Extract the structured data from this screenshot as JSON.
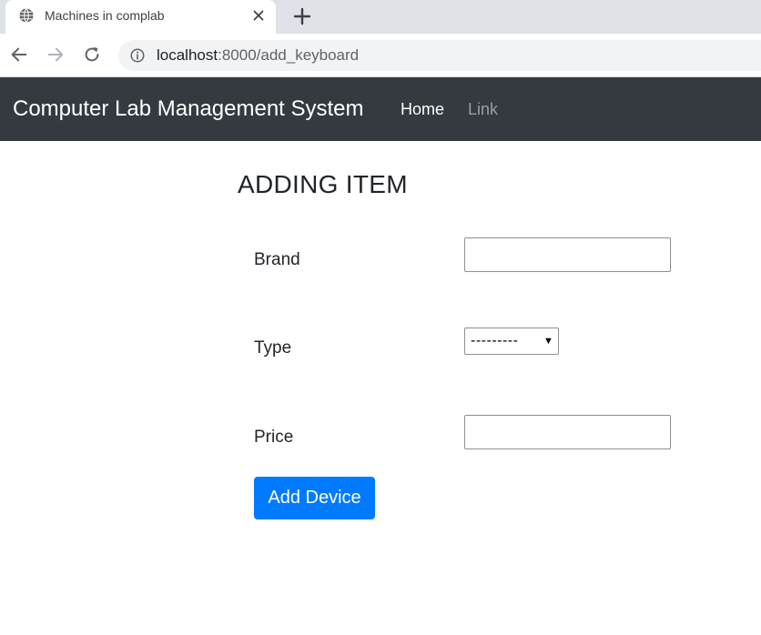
{
  "browser": {
    "tab": {
      "title": "Machines in complab",
      "favicon": "globe-icon",
      "close_icon": "close-icon"
    },
    "new_tab_icon": "plus-icon",
    "nav": {
      "back_icon": "arrow-left-icon",
      "forward_icon": "arrow-right-icon",
      "reload_icon": "reload-icon"
    },
    "address": {
      "info_icon": "info-icon",
      "host": "localhost",
      "path": ":8000/add_keyboard"
    }
  },
  "navbar": {
    "brand": "Computer Lab Management System",
    "links": [
      {
        "label": "Home",
        "active": true
      },
      {
        "label": "Link",
        "active": false
      }
    ],
    "background": "#343a40"
  },
  "form": {
    "heading": "ADDING ITEM",
    "fields": {
      "brand": {
        "label": "Brand",
        "value": ""
      },
      "type": {
        "label": "Type",
        "selected": "---------"
      },
      "price": {
        "label": "Price",
        "value": ""
      }
    },
    "submit_label": "Add Device",
    "accent": "#007bff"
  }
}
